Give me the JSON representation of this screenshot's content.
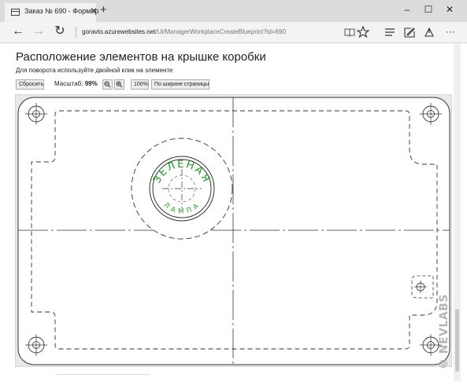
{
  "browser": {
    "tab_title": "Заказ № 690 - Формир",
    "tab_close": "✕",
    "new_tab": "+",
    "minimize": "–",
    "maximize": "☐",
    "close": "✕",
    "back": "←",
    "forward": "→",
    "refresh": "↻",
    "address_host": "goravto.azurewebsites.net",
    "address_path": "/Ui/ManagerWorkplaceCreateBlueprint?id=690",
    "more": "···"
  },
  "page": {
    "title": "Расположение элементов на крышке коробки",
    "hint": "Для поворота используйте двойной клик на элементе"
  },
  "toolbar": {
    "reset_label": "Сбросить",
    "scale_label": "Масштаб:",
    "scale_value": "99%",
    "zoom_out_icon": "zoom-out-icon",
    "zoom_in_icon": "zoom-in-icon",
    "zoom_100_label": "100%",
    "fit_width_label": "По ширине страницы"
  },
  "blueprint": {
    "ring_text_top": "ЗЕЛЕНАЯ",
    "ring_text_bottom": "ЛАМПА",
    "ring_text_color": "#1aa11a",
    "line_color": "#333333"
  },
  "watermark": "© NEVLABS"
}
